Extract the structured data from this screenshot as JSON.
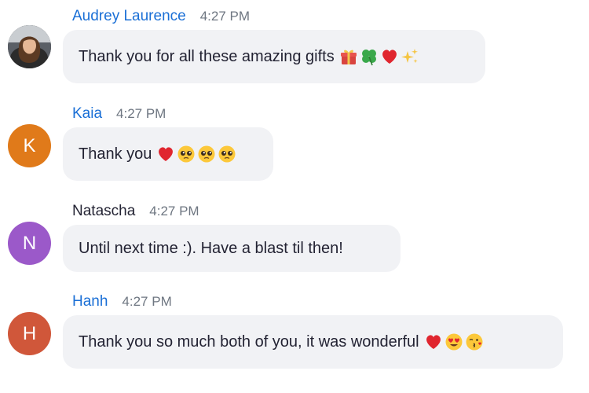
{
  "messages": [
    {
      "sender": "Audrey Laurence",
      "time": "4:27 PM",
      "text": "Thank you for all these amazing gifts",
      "emojis": [
        "gift",
        "four-leaf-clover",
        "red-heart",
        "sparkles"
      ],
      "avatar": {
        "type": "photo",
        "initial": ""
      },
      "name_color": "#1a6fd6"
    },
    {
      "sender": "Kaia",
      "time": "4:27 PM",
      "text": "Thank you",
      "emojis": [
        "red-heart",
        "pleading-face",
        "pleading-face",
        "pleading-face"
      ],
      "avatar": {
        "type": "initial",
        "initial": "K",
        "color": "#e07a1a"
      },
      "name_color": "#1a6fd6"
    },
    {
      "sender": "Natascha",
      "time": "4:27 PM",
      "text": "Until next time :). Have a blast til then!",
      "emojis": [],
      "avatar": {
        "type": "initial",
        "initial": "N",
        "color": "#9b59c9"
      },
      "name_color": "#232333"
    },
    {
      "sender": "Hanh",
      "time": "4:27 PM",
      "text": "Thank you so much both of you, it was wonderful",
      "emojis": [
        "red-heart",
        "heart-eyes-face",
        "kissing-face"
      ],
      "avatar": {
        "type": "initial",
        "initial": "H",
        "color": "#d0573a"
      },
      "name_color": "#1a6fd6"
    }
  ]
}
